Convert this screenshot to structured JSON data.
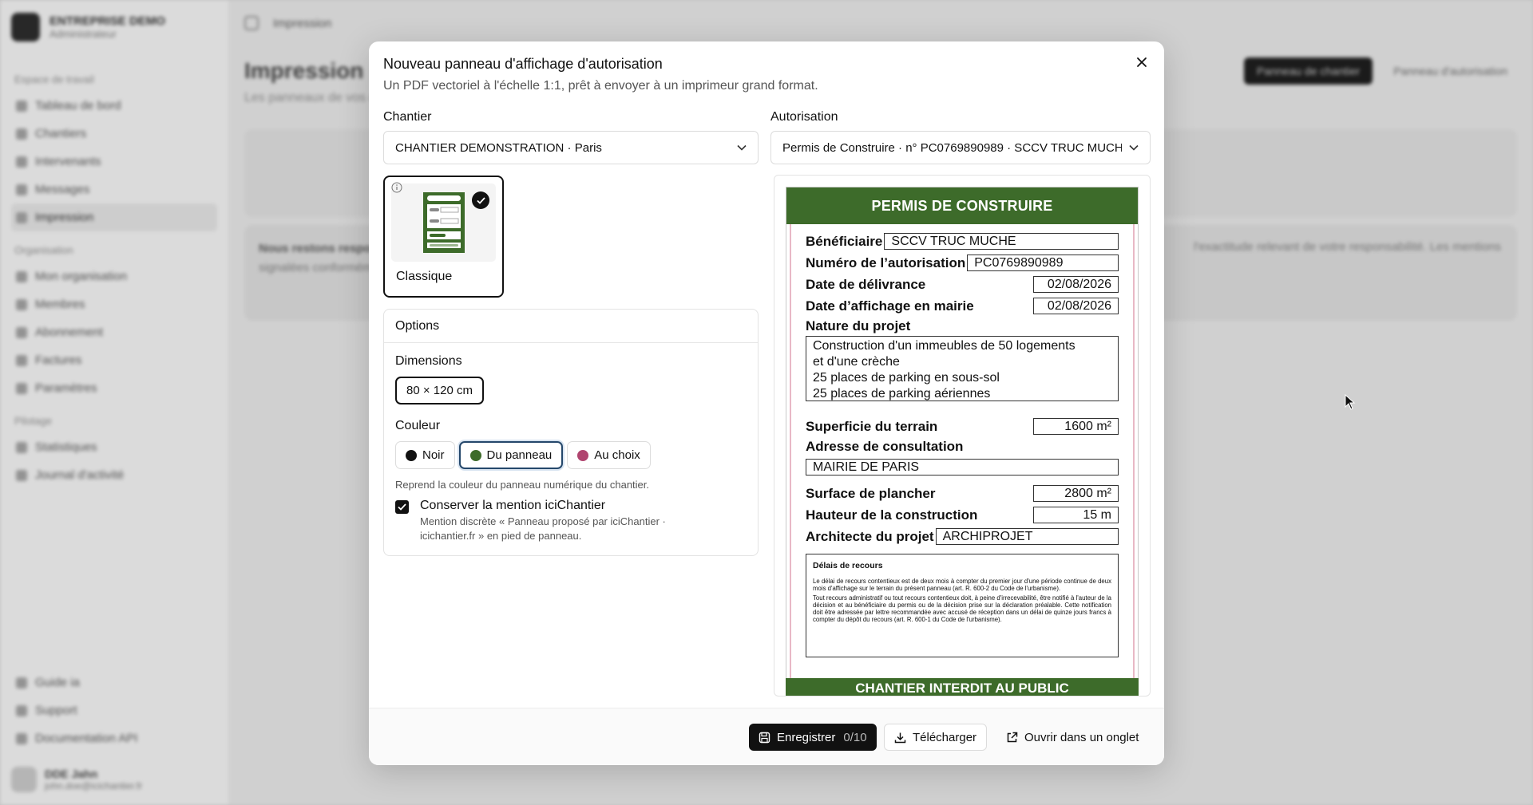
{
  "app": {
    "org_name": "ENTREPRISE DEMO",
    "org_role": "Administrateur",
    "sections": [
      {
        "title": "Espace de travail",
        "items": [
          "Tableau de bord",
          "Chantiers",
          "Intervenants",
          "Messages",
          "Impression"
        ]
      },
      {
        "title": "Organisation",
        "items": [
          "Mon organisation",
          "Membres",
          "Abonnement",
          "Factures",
          "Paramètres"
        ]
      },
      {
        "title": "Pilotage",
        "items": [
          "Statistiques",
          "Journal d'activité"
        ]
      }
    ],
    "bottom_items": [
      "Guide ia",
      "Support",
      "Documentation API"
    ],
    "user_name": "DDE Jahn",
    "user_mail": "john.doe@icichantier.fr",
    "breadcrumb": "Impression",
    "page_title": "Impression",
    "page_sub": "Les panneaux de vos chantiers",
    "btn_new_site_panel": "Panneau de chantier",
    "btn_new_auth_panel": "Panneau d'autorisation",
    "notice_title": "Nous restons responsables",
    "notice_text": "signalées conformément à vos règles. Un panneau officiel",
    "notice_tail": "l'exactitude relevant de votre responsabilité. Les mentions"
  },
  "modal": {
    "title": "Nouveau panneau d'affichage d'autorisation",
    "subtitle": "Un PDF vectoriel à l'échelle 1:1, prêt à envoyer à un imprimeur grand format.",
    "chantier_label": "Chantier",
    "chantier_value": "CHANTIER DEMONSTRATION · Paris",
    "autorisation_label": "Autorisation",
    "autorisation_value": "Permis de Construire · n° PC0769890989 · SCCV TRUC MUCHE",
    "template_label": "Classique",
    "options_title": "Options",
    "dimensions_label": "Dimensions",
    "dimension_value": "80 × 120 cm",
    "couleur_label": "Couleur",
    "colors": [
      {
        "label": "Noir",
        "color": "#111111"
      },
      {
        "label": "Du panneau",
        "color": "#3d6b2a"
      },
      {
        "label": "Au choix",
        "color": "#b0446f"
      }
    ],
    "couleur_hint": "Reprend la couleur du panneau numérique du chantier.",
    "keep_mention_title": "Conserver la mention iciChantier",
    "keep_mention_desc": "Mention discrète « Panneau proposé par iciChantier · icichantier.fr » en pied de panneau.",
    "footer": {
      "save_label": "Enregistrer",
      "save_count": "0/10",
      "download_label": "Télécharger",
      "open_label": "Ouvrir dans un onglet"
    }
  },
  "panel": {
    "accent": "#3d6b2a",
    "title": "PERMIS DE CONSTRUIRE",
    "beneficiaire_label": "Bénéficiaire",
    "beneficiaire": "SCCV TRUC MUCHE",
    "numero_label": "Numéro de l’autorisation",
    "numero": "PC0769890989",
    "delivrance_label": "Date de délivrance",
    "delivrance": "02/08/2026",
    "affichage_label": "Date d’affichage en mairie",
    "affichage": "02/08/2026",
    "nature_label": "Nature du projet",
    "nature_lines": [
      "Construction d'un immeubles de 50 logements",
      "et d'une crèche",
      "25 places de parking en sous-sol",
      "25 places de parking aériennes"
    ],
    "superficie_label": "Superficie du terrain",
    "superficie": "1600 m²",
    "adresse_label": "Adresse de consultation",
    "adresse": "MAIRIE DE PARIS",
    "plancher_label": "Surface de plancher",
    "plancher": "2800 m²",
    "hauteur_label": "Hauteur de la construction",
    "hauteur": "15 m",
    "architecte_label": "Architecte du projet",
    "architecte": "ARCHIPROJET",
    "recours_title": "Délais de recours",
    "recours_p1": "Le délai de recours contentieux est de deux mois à compter du premier jour d'une période continue de deux mois d'affichage sur le terrain du présent panneau (art. R. 600-2 du Code de l'urbanisme).",
    "recours_p2": "Tout recours administratif ou tout recours contentieux doit, à peine d'irrecevabilité, être notifié à l'auteur de la décision et au bénéficiaire du permis ou de la décision prise sur la déclaration préalable. Cette notification doit être adressée par lettre recommandée avec accusé de réception dans un délai de quinze jours francs à compter du dépôt du recours (art. R. 600-1 du Code de l'urbanisme).",
    "footer": "CHANTIER INTERDIT AU PUBLIC"
  }
}
